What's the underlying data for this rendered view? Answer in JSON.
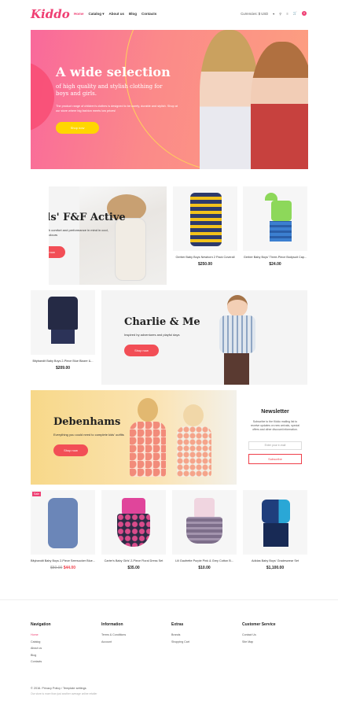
{
  "header": {
    "logo": "Kiddo",
    "nav": [
      "Home",
      "Catalog",
      "About us",
      "Blog",
      "Contacts"
    ],
    "currency_label": "Currencies: $ USD",
    "cart_count": "0"
  },
  "hero": {
    "title": "A wide selection",
    "subtitle": "of high quality and stylish clothing for boys and girls.",
    "description": "The product range of children's clothes is designed to be comfy, durable and stylish. Shop at our store where big fashion meets low prices!",
    "button": "Shop now"
  },
  "promo1": {
    "title": "Kids' F&F Active",
    "description": "Designed with comfort and performance in mind in cool, neon bright colours",
    "button": "Shop now"
  },
  "promo2": {
    "title": "Charlie & Me",
    "description": "Inspired by adventures and playful days",
    "button": "Shop now"
  },
  "promo3": {
    "title": "Debenhams",
    "description": "Everything you could need to complete kids' outfits",
    "button": "Shop now"
  },
  "products_row1": [
    {
      "name": "Gerber Baby Boys Newborn 2 Pack Coverall",
      "price": "$250.00"
    },
    {
      "name": "Gerber Baby Boys' Three-Piece Bodysuit Cap...",
      "price": "$24.00"
    }
  ],
  "product_blazer": {
    "name": "Bitybandit Baby Boys 2-Piece Blue Blazer &...",
    "price": "$209.00"
  },
  "newsletter": {
    "title": "Newsletter",
    "description": "Subscribe to the Kiddo mailing list to receive updates on new arrivals, special offers and other discount information.",
    "placeholder": "Enter your e-mail",
    "button": "Subscribe"
  },
  "products_row2": [
    {
      "name": "Bitybandit Baby Boys 2-Piece Seersucker Blue...",
      "old_price": "$50.00",
      "price": "$44.00",
      "badge": "Sale"
    },
    {
      "name": "Carter's Baby Girls' 2-Piece Floral Dress Set",
      "price": "$35.00"
    },
    {
      "name": "Lili Gaufrette Purple Pink & Grey Cotton B...",
      "price": "$10.00"
    },
    {
      "name": "Adidas Baby Boys' Gradeswear Set",
      "price": "$1,100.00"
    }
  ],
  "footer": {
    "navigation": {
      "title": "Navigation",
      "links": [
        "Home",
        "Catalog",
        "About us",
        "Blog",
        "Contacts"
      ]
    },
    "information": {
      "title": "Information",
      "links": [
        "Terms & Conditions",
        "Account"
      ]
    },
    "extras": {
      "title": "Extras",
      "links": [
        "Brands",
        "Shopping Cart"
      ]
    },
    "customer_service": {
      "title": "Customer Service",
      "links": [
        "Contact Us",
        "Site Map"
      ]
    },
    "copyright": "© 2016. Privacy Policy  /  Template settings",
    "note": "Our store is more than just another average online retailer"
  },
  "colors": {
    "brand": "#ef3f73",
    "button": "#f24e56",
    "hero_button": "#ffd600"
  }
}
